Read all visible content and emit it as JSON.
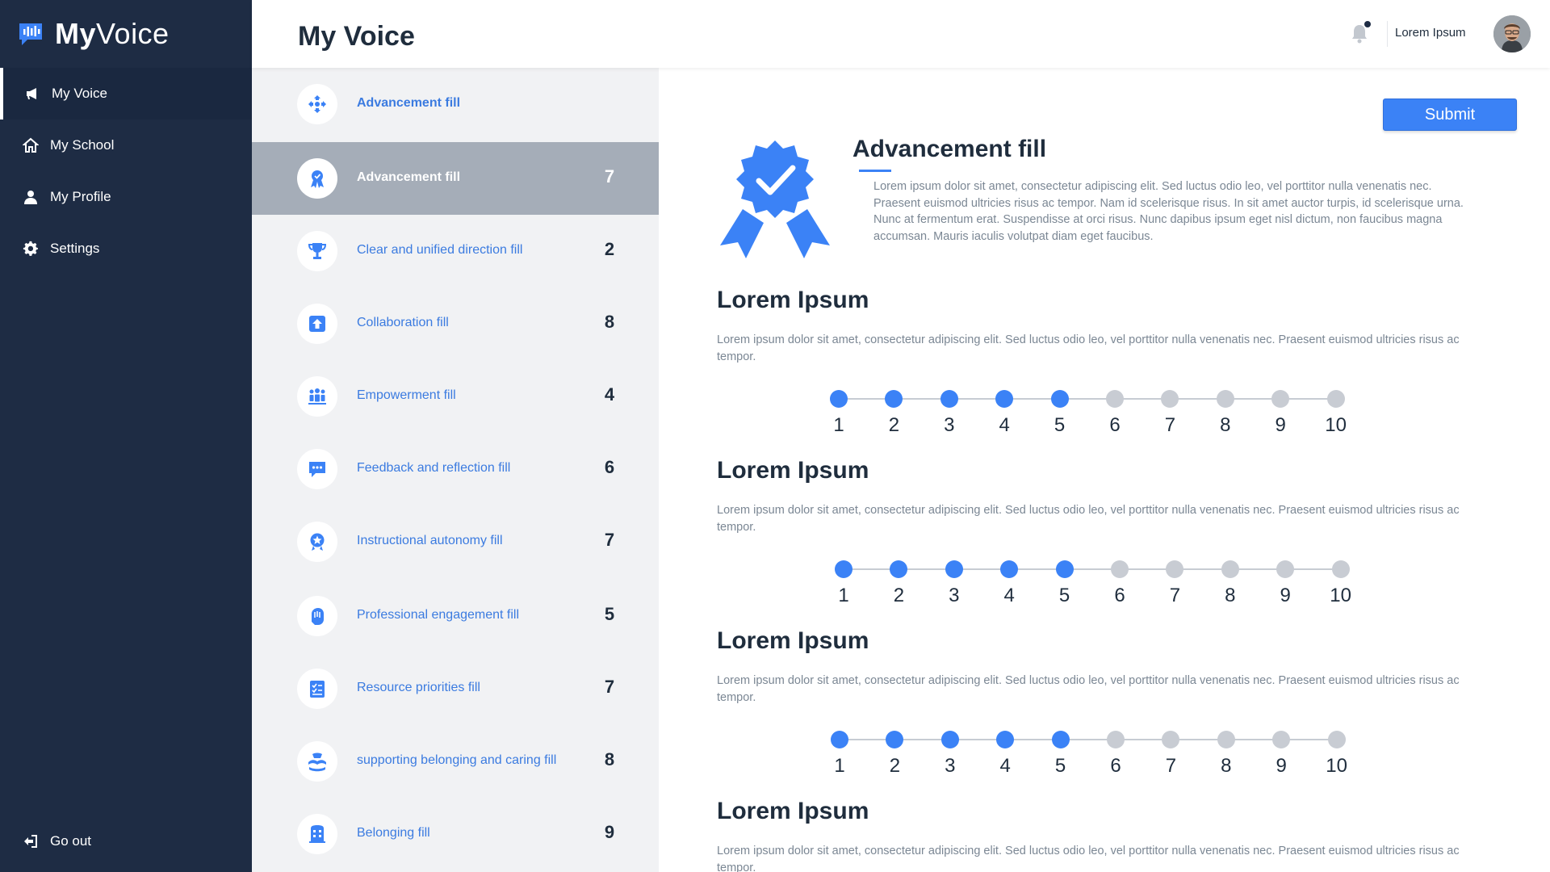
{
  "app": {
    "logo_bold": "My",
    "logo_light": "Voice"
  },
  "sidebar": {
    "items": [
      {
        "label": "My Voice",
        "icon": "megaphone-icon"
      },
      {
        "label": "My School",
        "icon": "home-icon"
      },
      {
        "label": "My Profile",
        "icon": "person-icon"
      },
      {
        "label": "Settings",
        "icon": "gear-icon"
      }
    ],
    "go_out": "Go out"
  },
  "header": {
    "title": "My Voice",
    "user_name": "Lorem Ipsum"
  },
  "categories": [
    {
      "label": "Advancement fill",
      "score": "",
      "icon": "diamond-arrows-icon"
    },
    {
      "label": "Advancement fill",
      "score": "7",
      "icon": "award-ribbon-icon"
    },
    {
      "label": "Clear and unified direction fill",
      "score": "2",
      "icon": "trophy-icon"
    },
    {
      "label": "Collaboration fill",
      "score": "8",
      "icon": "upload-box-icon"
    },
    {
      "label": "Empowerment fill",
      "score": "4",
      "icon": "group-icon"
    },
    {
      "label": "Feedback and reflection fill",
      "score": "6",
      "icon": "chat-bubble-icon"
    },
    {
      "label": "Instructional autonomy fill",
      "score": "7",
      "icon": "star-medal-icon"
    },
    {
      "label": "Professional engagement fill",
      "score": "5",
      "icon": "hand-icon"
    },
    {
      "label": "Resource priorities fill",
      "score": "7",
      "icon": "checklist-icon"
    },
    {
      "label": "supporting belonging and caring fill",
      "score": "8",
      "icon": "caring-hands-icon"
    },
    {
      "label": "Belonging fill",
      "score": "9",
      "icon": "building-icon"
    }
  ],
  "detail": {
    "submit_label": "Submit",
    "title": "Advancement fill",
    "description": "Lorem ipsum dolor sit amet, consectetur adipiscing elit. Sed luctus odio leo, vel porttitor nulla venenatis nec. Praesent euismod ultricies risus ac tempor. Nam id scelerisque risus. In sit amet auctor turpis, id scelerisque urna. Nunc at fermentum erat. Suspendisse at orci risus. Nunc dapibus ipsum eget nisl dictum, non faucibus magna accumsan. Mauris iaculis volutpat diam eget faucibus.",
    "questions": [
      {
        "title": "Lorem Ipsum",
        "description": "Lorem ipsum dolor sit amet, consectetur adipiscing elit. Sed luctus odio leo, vel porttitor nulla venenatis nec. Praesent euismod ultricies risus ac tempor.",
        "rating": 5
      },
      {
        "title": "Lorem Ipsum",
        "description": "Lorem ipsum dolor sit amet, consectetur adipiscing elit. Sed luctus odio leo, vel porttitor nulla venenatis nec. Praesent euismod ultricies risus ac tempor.",
        "rating": 5
      },
      {
        "title": "Lorem Ipsum",
        "description": "Lorem ipsum dolor sit amet, consectetur adipiscing elit. Sed luctus odio leo, vel porttitor nulla venenatis nec. Praesent euismod ultricies risus ac tempor.",
        "rating": 5
      },
      {
        "title": "Lorem Ipsum",
        "description": "Lorem ipsum dolor sit amet, consectetur adipiscing elit. Sed luctus odio leo, vel porttitor nulla venenatis nec. Praesent euismod ultricies risus ac tempor.",
        "rating": null
      }
    ],
    "scale": [
      "1",
      "2",
      "3",
      "4",
      "5",
      "6",
      "7",
      "8",
      "9",
      "10"
    ]
  },
  "colors": {
    "sidebar_bg": "#1e2c44",
    "accent": "#3b82f6",
    "selected_row": "#a5adb8",
    "inactive_dot": "#c8ccd3"
  }
}
